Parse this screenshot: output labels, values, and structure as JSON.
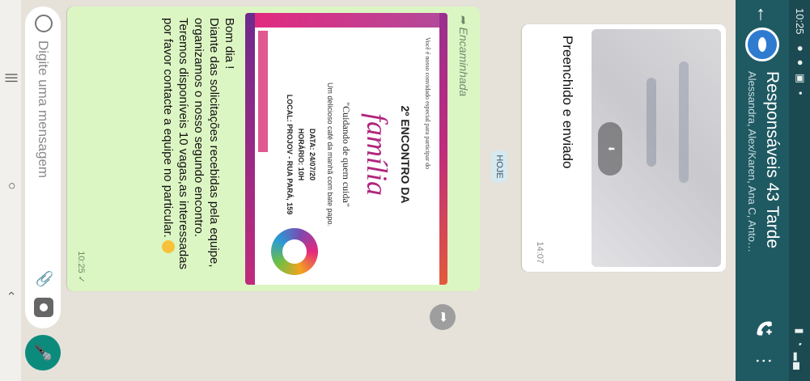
{
  "status": {
    "time": "10:25"
  },
  "header": {
    "title": "Responsáveis 43 Tarde",
    "subtitle": "Alessandra, Alex/Karen, Ana C, Antonia/K..."
  },
  "messages": {
    "incoming": {
      "caption": "Preenchido e enviado",
      "time": "14:07"
    },
    "date_chip": "HOJE",
    "outgoing": {
      "forwarded_label": "Encaminhada",
      "flyer": {
        "invite": "Você é nosso convidado especial para participar do",
        "title": "2º ENCONTRO DA",
        "headline": "família",
        "quote": "\"Cuidando de quem cuida\"",
        "subtitle": "Um delicioso café da manhã com bate papo.",
        "date": "DATA: 24/07/20",
        "hour": "HORÁRIO: 10H",
        "place": "LOCAL: PROJOV - RUA PARÁ, 159"
      },
      "text_lines": [
        "Bom dia !",
        "Diante das solicitações recebidas pela equipe, organizamos o nosso segundo encontro.",
        "Teremos disponíveis 10 vagas,as interessadas por favor contacte a equipe no particular."
      ],
      "time": "10:25 ✓"
    }
  },
  "composer": {
    "placeholder": "Digite uma mensagem"
  },
  "icons": [
    "back-arrow-icon",
    "group-avatar-icon",
    "add-call-icon",
    "more-vert-icon",
    "forward-icon",
    "emoji-icon",
    "attach-icon",
    "camera-icon",
    "mic-icon"
  ],
  "colors": {
    "appbar": "#1f5a63",
    "outgoing_bubble": "#dcf6c3",
    "accent": "#0c8a7c"
  }
}
